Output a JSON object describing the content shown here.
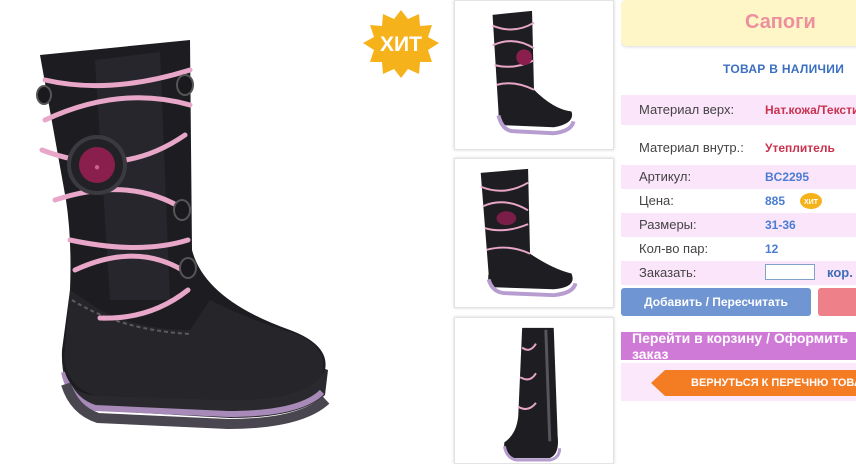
{
  "main_image": {
    "badge": "ХИТ",
    "alt": "boot"
  },
  "thumbnails": [
    {
      "name": "thumb-1"
    },
    {
      "name": "thumb-2"
    },
    {
      "name": "thumb-3"
    }
  ],
  "product": {
    "title": "Сапоги",
    "stock": "ТОВАР В НАЛИЧИИ",
    "rows": [
      {
        "label": "Материал верх:",
        "value": "Нат.кожа/Текстиль"
      },
      {
        "label": "Материал внутр.:",
        "value": "Утеплитель"
      },
      {
        "label": "Артикул:",
        "value": "BC2295"
      },
      {
        "label": "Цена:",
        "value": "885",
        "badge": "ХИТ"
      },
      {
        "label": "Размеры:",
        "value": "31-36"
      },
      {
        "label": "Кол-во пар:",
        "value": "12"
      },
      {
        "label": "Заказать:",
        "value": "",
        "unit": "кор."
      }
    ],
    "add_button": "Добавить / Пересчитать",
    "cart_button": "Перейти в корзину / Оформить заказ",
    "back_button": "ВЕРНУТЬСЯ К ПЕРЕЧНЮ ТОВАРОВ"
  }
}
